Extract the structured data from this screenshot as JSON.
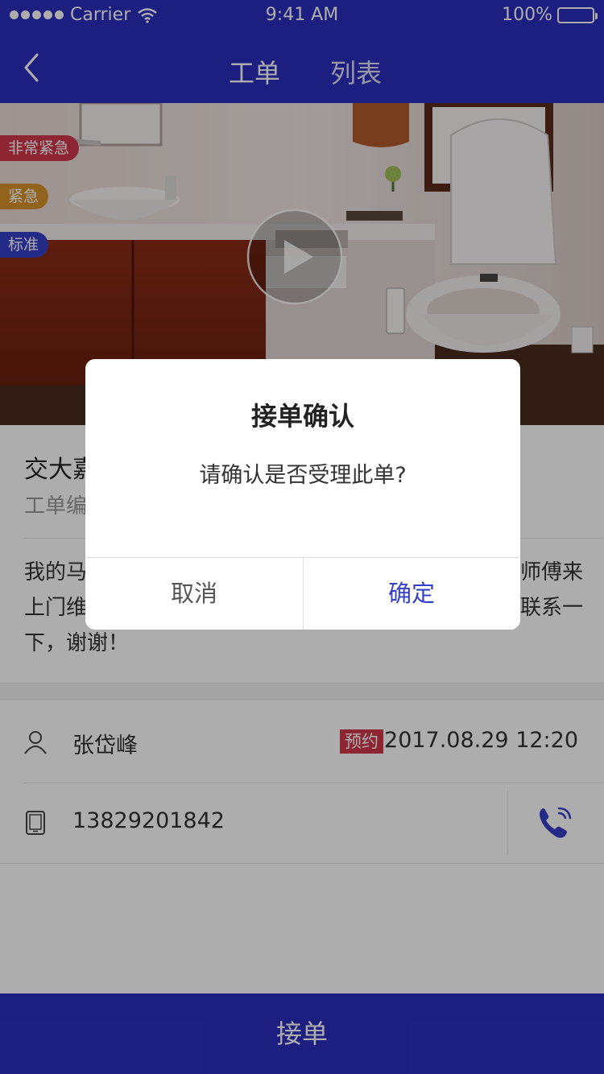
{
  "status_bar": {
    "carrier": "Carrier",
    "time": "9:41 AM",
    "battery": "100%"
  },
  "nav": {
    "tabs": [
      {
        "label": "工单",
        "active": true
      },
      {
        "label": "列表",
        "active": false
      }
    ]
  },
  "hero": {
    "tags": [
      "非常紧急",
      "紧急",
      "标准"
    ],
    "tag_colors": [
      "#d0384a",
      "#d8932c",
      "#3540c8"
    ]
  },
  "order": {
    "title_visible": "交大嘉",
    "number_label_visible": "工单编",
    "description_lines": [
      "我的马",
      "师傅来",
      "上门维",
      "联系一",
      "下，谢谢！"
    ]
  },
  "contact": {
    "name": "张岱峰",
    "badge": "预约",
    "datetime": "2017.08.29 12:20",
    "phone": "13829201842"
  },
  "bottom_bar": {
    "label": "接单"
  },
  "dialog": {
    "title": "接单确认",
    "message": "请确认是否受理此单?",
    "cancel": "取消",
    "confirm": "确定"
  },
  "colors": {
    "brand": "#2b2fbd",
    "accent": "#3540c8",
    "danger": "#d0384a"
  }
}
